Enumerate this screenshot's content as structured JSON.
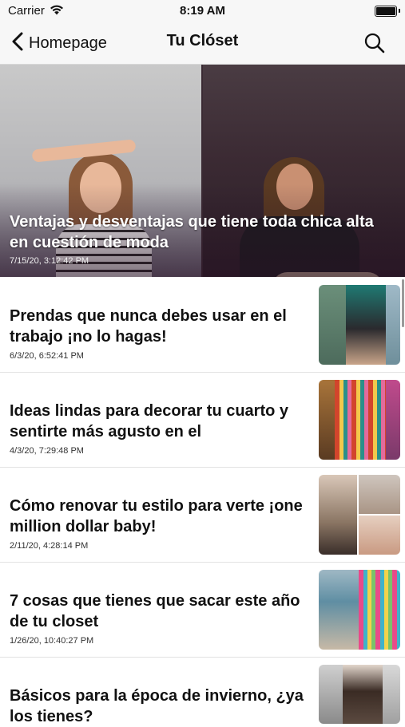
{
  "status_bar": {
    "carrier": "Carrier",
    "time": "8:19 AM"
  },
  "nav": {
    "back_label": "Homepage",
    "title": "Tu Clóset"
  },
  "hero": {
    "title": "Ventajas y desventajas que tiene toda chica alta en cuestión de moda",
    "date": "7/15/20, 3:12:42 PM"
  },
  "articles": [
    {
      "title": "Prendas que nunca debes usar en el trabajo ¡no lo hagas!",
      "date": "6/3/20, 6:52:41 PM"
    },
    {
      "title": "Ideas lindas para decorar tu cuarto y sentirte más agusto en el",
      "date": "4/3/20, 7:29:48 PM"
    },
    {
      "title": "Cómo renovar tu estilo para verte ¡one million dollar baby!",
      "date": "2/11/20, 4:28:14 PM"
    },
    {
      "title": "7 cosas que tienes que sacar este año de tu closet",
      "date": "1/26/20, 10:40:27 PM"
    },
    {
      "title": "Básicos para la época de invierno, ¿ya los tienes?",
      "date": ""
    }
  ],
  "icons": {
    "back": "chevron-left-icon",
    "search": "search-icon",
    "wifi": "wifi-icon",
    "battery": "battery-icon"
  },
  "colors": {
    "bar_background": "#f7f7f7",
    "text": "#111111",
    "hero_text": "#ffffff"
  }
}
